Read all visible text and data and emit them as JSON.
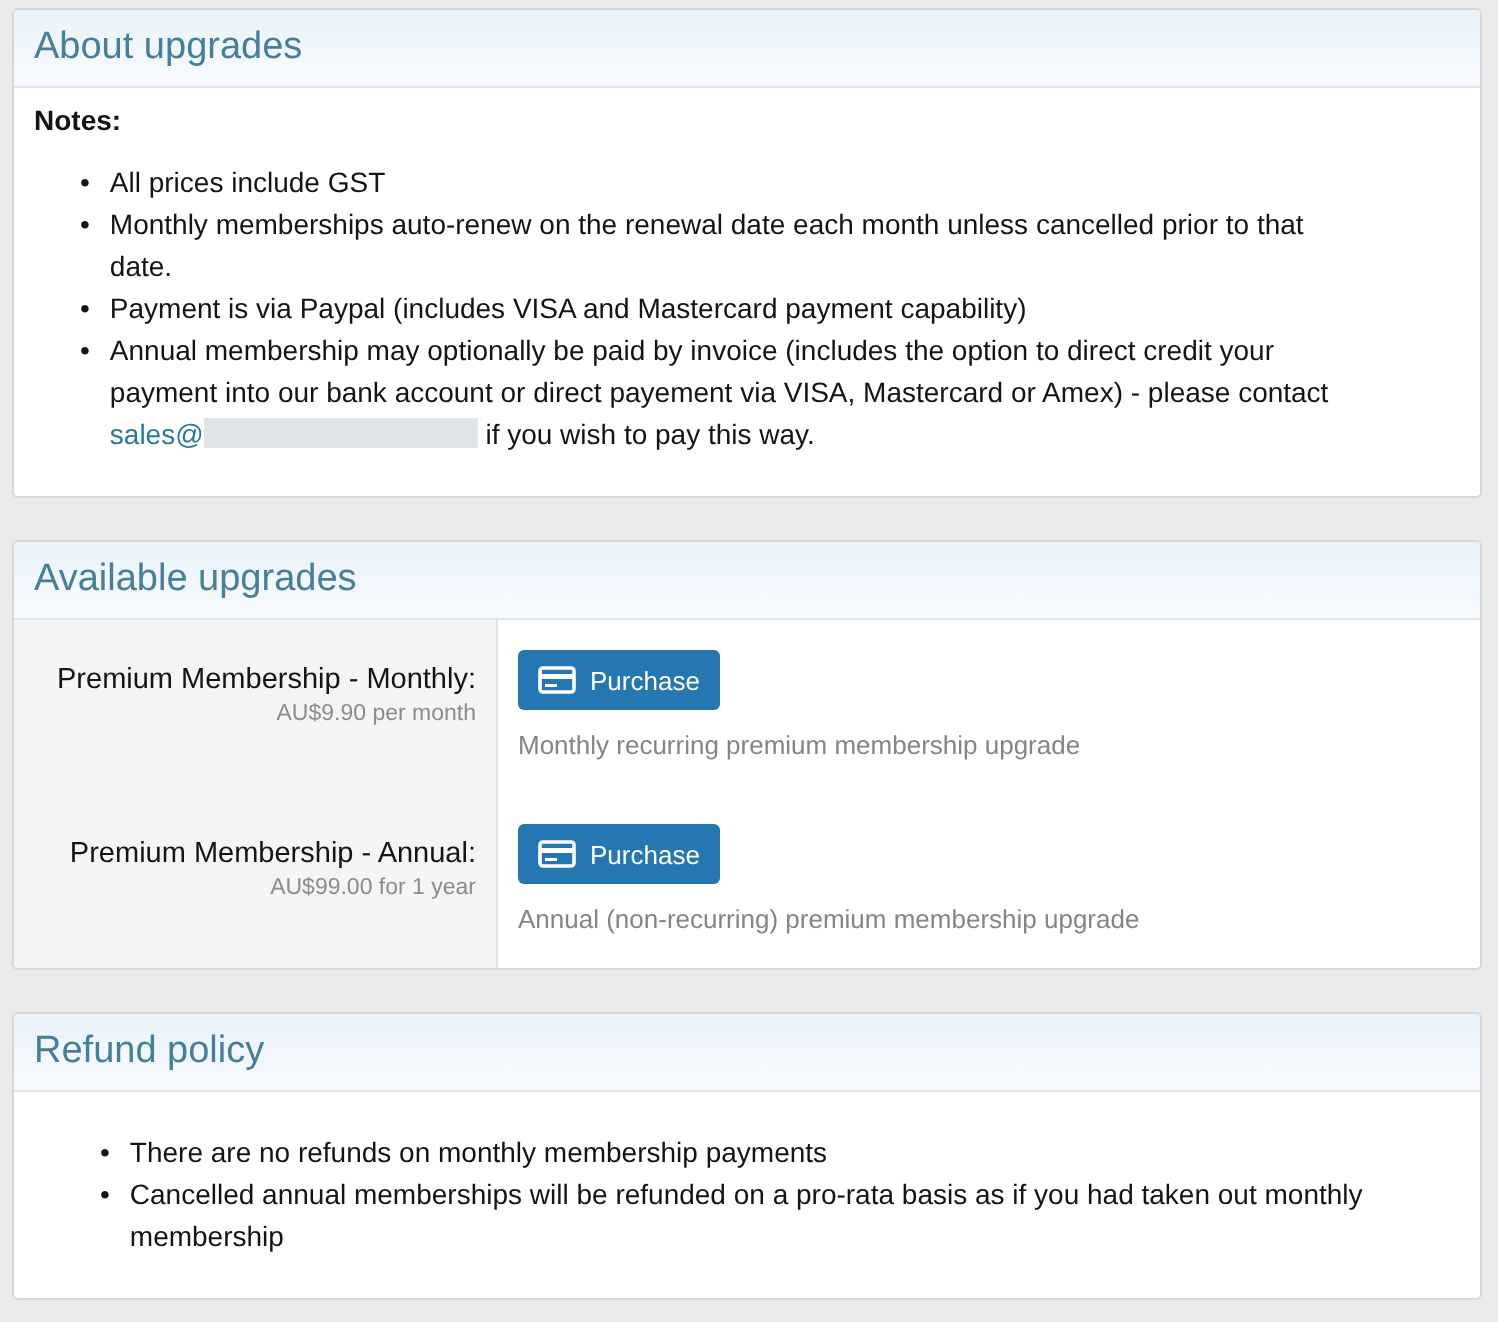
{
  "about": {
    "title": "About upgrades",
    "heading": "Notes:",
    "items": [
      {
        "bullet": "•",
        "text": "All prices include GST"
      },
      {
        "bullet": "•",
        "text": "Monthly memberships auto-renew on the renewal date each month unless cancelled prior to that date."
      },
      {
        "bullet": "•",
        "text": "Payment is via Paypal (includes VISA and Mastercard payment capability)"
      },
      {
        "bullet": "•",
        "text": "Annual membership may optionally be paid by invoice (includes the option to direct credit your payment into our bank account or direct payement via VISA, Mastercard or Amex) - please contact",
        "link": "sales@",
        "redacted": true,
        "after": "if you wish to pay this way."
      }
    ]
  },
  "upgrades": {
    "title": "Available upgrades",
    "rows": [
      {
        "name": "Premium Membership - Monthly:",
        "price": "AU$9.90 per month",
        "button": "Purchase",
        "description": "Monthly recurring premium membership upgrade"
      },
      {
        "name": "Premium Membership - Annual:",
        "price": "AU$99.00 for 1 year",
        "button": "Purchase",
        "description": "Annual (non-recurring) premium membership upgrade"
      }
    ]
  },
  "refund": {
    "title": "Refund policy",
    "items": [
      {
        "bullet": "•",
        "text": "There are no refunds on monthly membership payments"
      },
      {
        "bullet": "•",
        "text": "Cancelled annual memberships will be refunded on a pro-rata basis as if you had taken out monthly membership"
      }
    ]
  }
}
